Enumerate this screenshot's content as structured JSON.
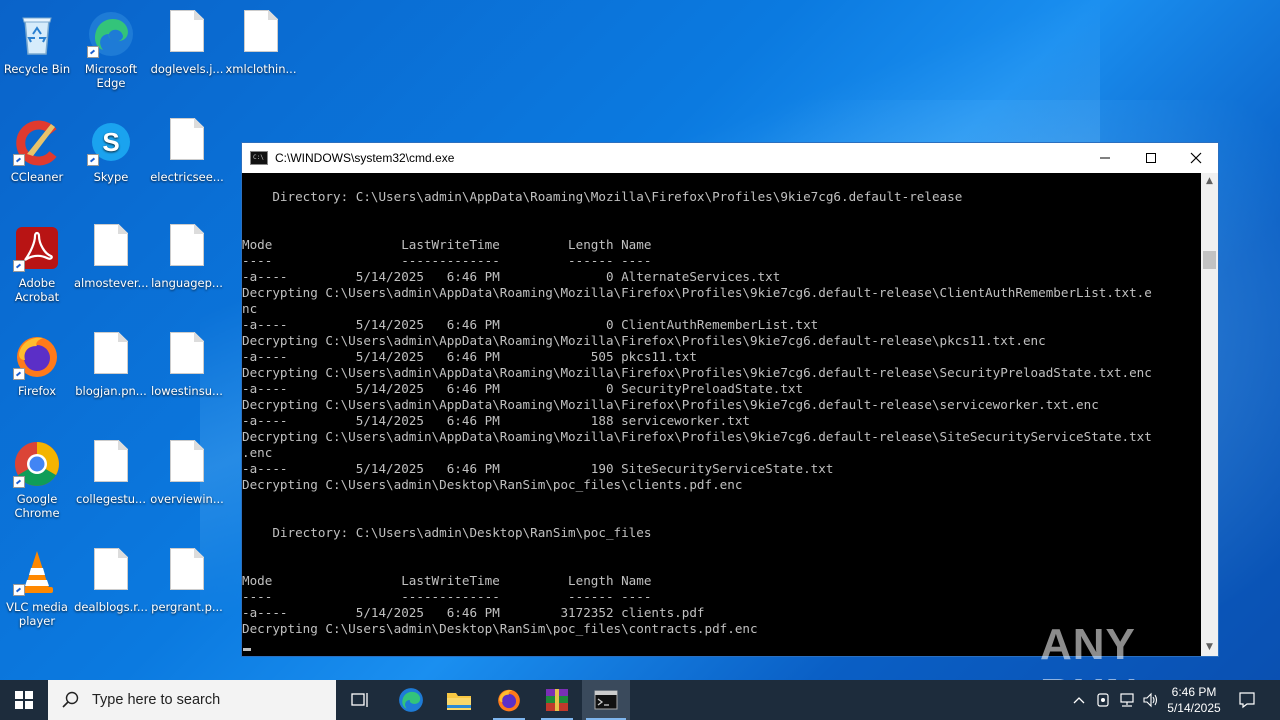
{
  "desktop": {
    "icons": [
      {
        "label": "Recycle Bin",
        "icon": "recycle-bin-icon"
      },
      {
        "label": "Microsoft Edge",
        "icon": "edge-icon"
      },
      {
        "label": "doglevels.j...",
        "icon": "file-icon"
      },
      {
        "label": "xmlclothin...",
        "icon": "file-icon"
      },
      {
        "label": "CCleaner",
        "icon": "ccleaner-icon"
      },
      {
        "label": "Skype",
        "icon": "skype-icon"
      },
      {
        "label": "electricsee...",
        "icon": "file-icon"
      },
      {
        "label": "Adobe Acrobat",
        "icon": "acrobat-icon"
      },
      {
        "label": "almostever...",
        "icon": "file-icon"
      },
      {
        "label": "languagep...",
        "icon": "file-icon"
      },
      {
        "label": "Firefox",
        "icon": "firefox-icon"
      },
      {
        "label": "blogjan.pn...",
        "icon": "file-icon"
      },
      {
        "label": "lowestinsu...",
        "icon": "file-icon"
      },
      {
        "label": "Google Chrome",
        "icon": "chrome-icon"
      },
      {
        "label": "collegestu...",
        "icon": "file-icon"
      },
      {
        "label": "overviewin...",
        "icon": "file-icon"
      },
      {
        "label": "VLC media player",
        "icon": "vlc-icon"
      },
      {
        "label": "dealblogs.r...",
        "icon": "file-icon"
      },
      {
        "label": "pergrant.p...",
        "icon": "file-icon"
      }
    ]
  },
  "cmd_window": {
    "title": "C:\\WINDOWS\\system32\\cmd.exe",
    "console_lines": [
      "",
      "    Directory: C:\\Users\\admin\\AppData\\Roaming\\Mozilla\\Firefox\\Profiles\\9kie7cg6.default-release",
      "",
      "",
      "Mode                 LastWriteTime         Length Name",
      "----                 -------------         ------ ----",
      "-a----         5/14/2025   6:46 PM              0 AlternateServices.txt",
      "Decrypting C:\\Users\\admin\\AppData\\Roaming\\Mozilla\\Firefox\\Profiles\\9kie7cg6.default-release\\ClientAuthRememberList.txt.e",
      "nc",
      "-a----         5/14/2025   6:46 PM              0 ClientAuthRememberList.txt",
      "Decrypting C:\\Users\\admin\\AppData\\Roaming\\Mozilla\\Firefox\\Profiles\\9kie7cg6.default-release\\pkcs11.txt.enc",
      "-a----         5/14/2025   6:46 PM            505 pkcs11.txt",
      "Decrypting C:\\Users\\admin\\AppData\\Roaming\\Mozilla\\Firefox\\Profiles\\9kie7cg6.default-release\\SecurityPreloadState.txt.enc",
      "-a----         5/14/2025   6:46 PM              0 SecurityPreloadState.txt",
      "Decrypting C:\\Users\\admin\\AppData\\Roaming\\Mozilla\\Firefox\\Profiles\\9kie7cg6.default-release\\serviceworker.txt.enc",
      "-a----         5/14/2025   6:46 PM            188 serviceworker.txt",
      "Decrypting C:\\Users\\admin\\AppData\\Roaming\\Mozilla\\Firefox\\Profiles\\9kie7cg6.default-release\\SiteSecurityServiceState.txt",
      ".enc",
      "-a----         5/14/2025   6:46 PM            190 SiteSecurityServiceState.txt",
      "Decrypting C:\\Users\\admin\\Desktop\\RanSim\\poc_files\\clients.pdf.enc",
      "",
      "",
      "    Directory: C:\\Users\\admin\\Desktop\\RanSim\\poc_files",
      "",
      "",
      "Mode                 LastWriteTime         Length Name",
      "----                 -------------         ------ ----",
      "-a----         5/14/2025   6:46 PM        3172352 clients.pdf",
      "Decrypting C:\\Users\\admin\\Desktop\\RanSim\\poc_files\\contracts.pdf.enc"
    ]
  },
  "watermark": {
    "text": "ANY RUN"
  },
  "taskbar": {
    "search_placeholder": "Type here to search",
    "time": "6:46 PM",
    "date": "5/14/2025"
  },
  "colors": {
    "desktop": "#0b72d9",
    "taskbar": "#1d2c3c",
    "console_text": "#c0c0c0"
  }
}
